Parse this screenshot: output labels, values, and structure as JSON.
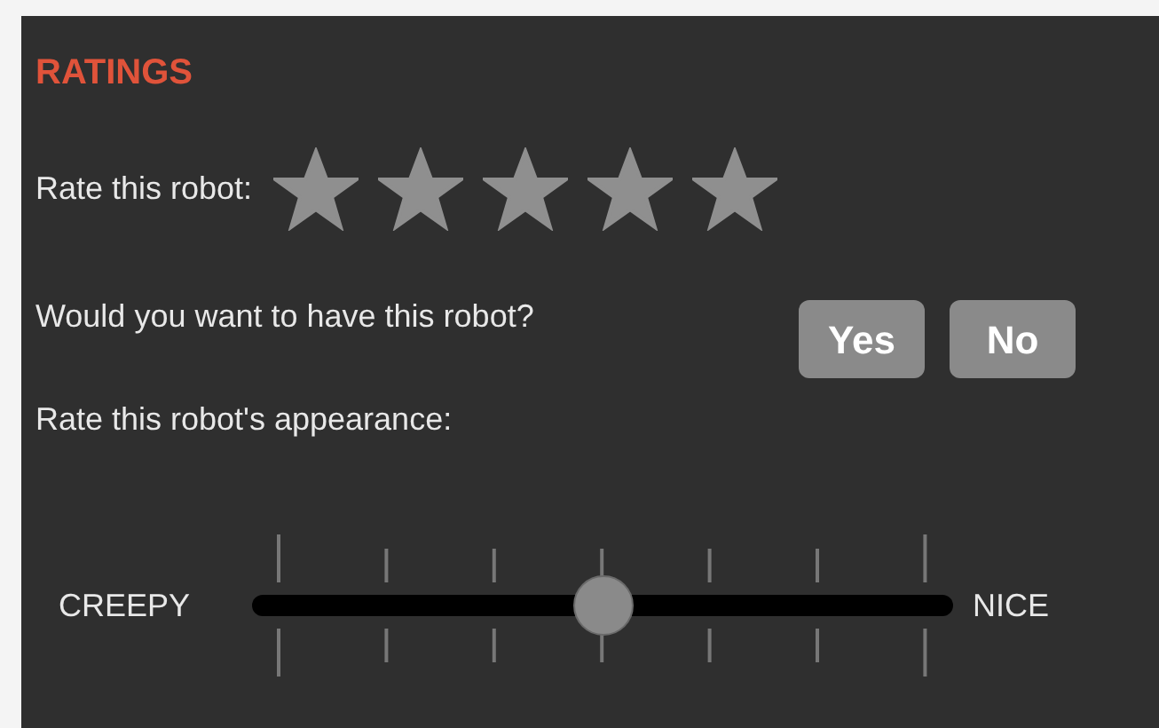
{
  "section": {
    "title": "RATINGS"
  },
  "rating": {
    "label": "Rate this robot:",
    "stars": 5
  },
  "question": {
    "label": "Would you want to have this robot?",
    "options": [
      {
        "label": "Yes",
        "selected": false
      },
      {
        "label": "No",
        "selected": false
      }
    ]
  },
  "appearance": {
    "label": "Rate this robot's appearance:",
    "min_label": "CREEPY",
    "max_label": "NICE",
    "level": 0.5
  }
}
